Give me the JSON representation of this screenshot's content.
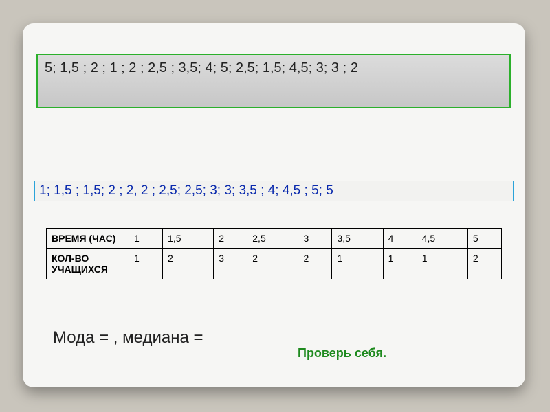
{
  "raw_sequence": "5;   1,5 ;    2   ;   1 ;     2 ;    2,5 ;     3,5;     4;      5;     2,5; 1,5;   4,5;     3;    3   ; 2",
  "sorted_sequence": "1;  1,5 ;   1,5;   2 ;   2,   2 ;    2,5;   2,5;    3;    3;    3,5 ;  4;   4,5 ;   5; 5",
  "table": {
    "row1_label": "ВРЕМЯ (ЧАС)",
    "row2_label": "КОЛ-ВО УЧАЩИХСЯ",
    "times": [
      "1",
      "1,5",
      "2",
      "2,5",
      "3",
      "3,5",
      "4",
      "4,5",
      "5"
    ],
    "counts": [
      "1",
      "2",
      "3",
      "2",
      "2",
      "1",
      "1",
      "1",
      "2"
    ]
  },
  "answer_text": "Мода  =     ,  медиана  =",
  "check_text": "Проверь себя."
}
